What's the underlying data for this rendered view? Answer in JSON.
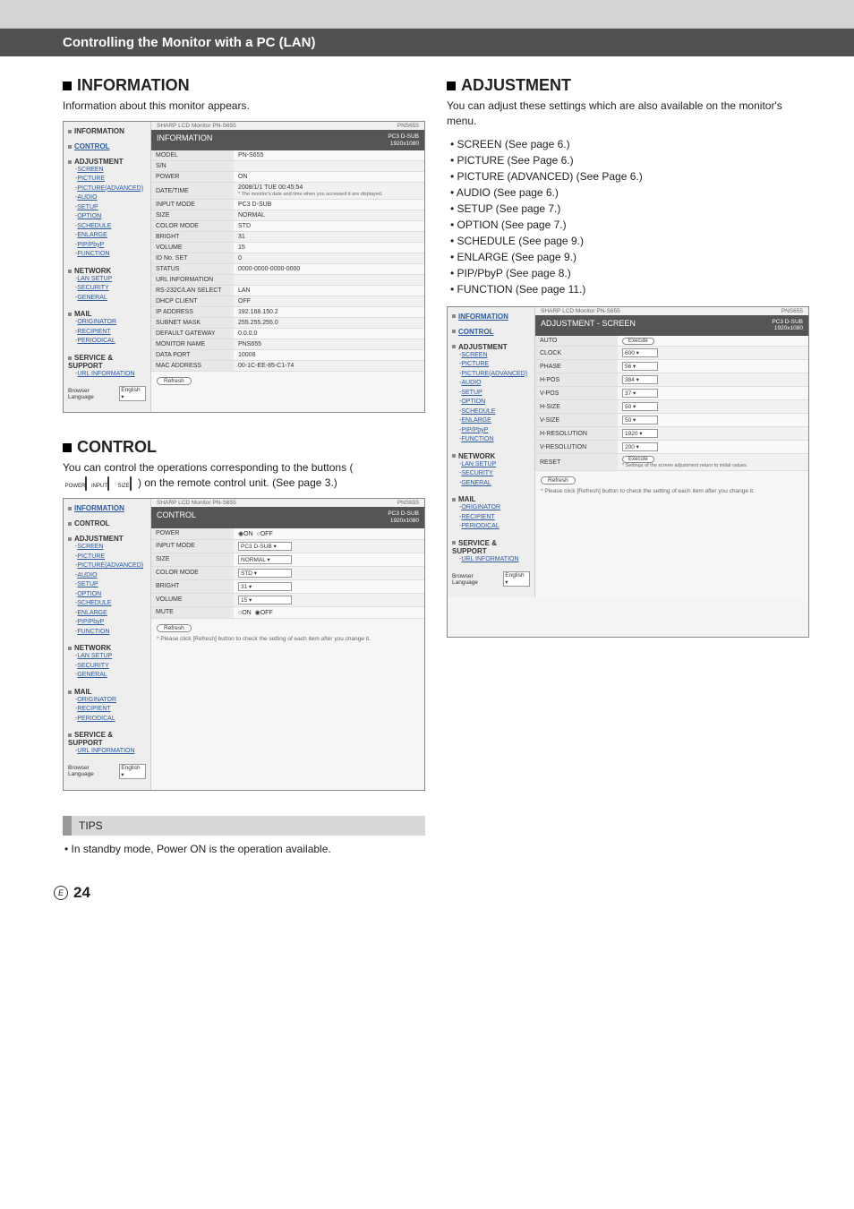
{
  "page": {
    "breadcrumb": "Controlling the Monitor with a PC (LAN)",
    "page_number": "24",
    "region_letter": "E"
  },
  "tips": {
    "label": "TIPS",
    "items": [
      "In standby mode, Power ON is the operation available."
    ]
  },
  "sections": {
    "information": {
      "heading": "INFORMATION",
      "lead": "Information about this monitor appears."
    },
    "control": {
      "heading": "CONTROL",
      "lead_pre": "You can control the operations corresponding to the buttons (",
      "lead_post": ") on the remote control unit. (See page 3.)",
      "remote_labels": {
        "power": "POWER",
        "input": "INPUT",
        "size": "SIZE"
      }
    },
    "adjustment": {
      "heading": "ADJUSTMENT",
      "lead": "You can adjust these settings which are also available on the monitor's menu.",
      "bullets": [
        "SCREEN (See page 6.)",
        "PICTURE (See Page 6.)",
        "PICTURE (ADVANCED) (See Page 6.)",
        "AUDIO (See page 6.)",
        "SETUP (See page 7.)",
        "OPTION (See page 7.)",
        "SCHEDULE (See page 9.)",
        "ENLARGE (See page 9.)",
        "PIP/PbyP (See page 8.)",
        "FUNCTION (See page 11.)"
      ]
    }
  },
  "nav": {
    "information": "INFORMATION",
    "control": "CONTROL",
    "adjustment": "ADJUSTMENT",
    "adjustment_items": [
      "SCREEN",
      "PICTURE",
      "PICTURE(ADVANCED)",
      "AUDIO",
      "SETUP",
      "OPTION",
      "SCHEDULE",
      "ENLARGE",
      "PIP/PbyP",
      "FUNCTION"
    ],
    "network": "NETWORK",
    "network_items": [
      "LAN SETUP",
      "SECURITY",
      "GENERAL"
    ],
    "mail": "MAIL",
    "mail_items": [
      "ORIGINATOR",
      "RECIPIENT",
      "PERIODICAL"
    ],
    "service": "SERVICE & SUPPORT",
    "service_items": [
      "URL INFORMATION"
    ],
    "lang_label": "Browser Language",
    "lang_value": "English"
  },
  "ss_common": {
    "monitor_label": "SHARP LCD Monitor PN-S655",
    "model_tag": "PNS655",
    "signal": "PC3 D-SUB",
    "res": "1920x1080",
    "refresh": "Refresh",
    "execute": "Execute",
    "helper": "* Please click [Refresh] button to check the setting of each item after you change it."
  },
  "ss_info": {
    "title": "INFORMATION",
    "rows": [
      [
        "MODEL",
        "PN-S655"
      ],
      [
        "S/N",
        ""
      ],
      [
        "POWER",
        "ON"
      ],
      [
        "DATE/TIME",
        "2008/1/1 TUE 00:45:54"
      ],
      [
        "INPUT MODE",
        "PC3 D-SUB"
      ],
      [
        "SIZE",
        "NORMAL"
      ],
      [
        "COLOR MODE",
        "STD"
      ],
      [
        "BRIGHT",
        "31"
      ],
      [
        "VOLUME",
        "15"
      ],
      [
        "ID No. SET",
        "0"
      ],
      [
        "STATUS",
        "0000-0000-0000-0000"
      ],
      [
        "URL INFORMATION",
        ""
      ],
      [
        "RS-232C/LAN SELECT",
        "LAN"
      ],
      [
        "DHCP CLIENT",
        "OFF"
      ],
      [
        "IP ADDRESS",
        "192.168.150.2"
      ],
      [
        "SUBNET MASK",
        "255.255.255.0"
      ],
      [
        "DEFAULT GATEWAY",
        "0.0.0.0"
      ],
      [
        "MONITOR NAME",
        "PNS655"
      ],
      [
        "DATA PORT",
        "10008"
      ],
      [
        "MAC ADDRESS",
        "00-1C-EE-85-C1-74"
      ]
    ],
    "date_note": "* The monitor's date and time when you accessed it are displayed."
  },
  "ss_control": {
    "title": "CONTROL",
    "rows": [
      {
        "label": "POWER",
        "type": "radio",
        "opts": [
          "ON",
          "OFF"
        ],
        "sel": 0
      },
      {
        "label": "INPUT MODE",
        "type": "select",
        "val": "PC3 D-SUB"
      },
      {
        "label": "SIZE",
        "type": "select",
        "val": "NORMAL"
      },
      {
        "label": "COLOR MODE",
        "type": "select",
        "val": "STD"
      },
      {
        "label": "BRIGHT",
        "type": "select",
        "val": "31"
      },
      {
        "label": "VOLUME",
        "type": "select",
        "val": "15"
      },
      {
        "label": "MUTE",
        "type": "radio",
        "opts": [
          "ON",
          "OFF"
        ],
        "sel": 1
      }
    ]
  },
  "ss_adjust": {
    "title": "ADJUSTMENT - SCREEN",
    "rows": [
      {
        "label": "AUTO",
        "type": "button"
      },
      {
        "label": "CLOCK",
        "type": "num",
        "val": "600"
      },
      {
        "label": "PHASE",
        "type": "num",
        "val": "56"
      },
      {
        "label": "H-POS",
        "type": "num",
        "val": "384"
      },
      {
        "label": "V-POS",
        "type": "num",
        "val": "37"
      },
      {
        "label": "H-SIZE",
        "type": "num",
        "val": "50"
      },
      {
        "label": "V-SIZE",
        "type": "num",
        "val": "50"
      },
      {
        "label": "H-RESOLUTION",
        "type": "num",
        "val": "1920"
      },
      {
        "label": "V-RESOLUTION",
        "type": "num",
        "val": "200"
      },
      {
        "label": "RESET",
        "type": "button",
        "note": "* Settings of the screen adjustment return to initial values."
      }
    ]
  }
}
